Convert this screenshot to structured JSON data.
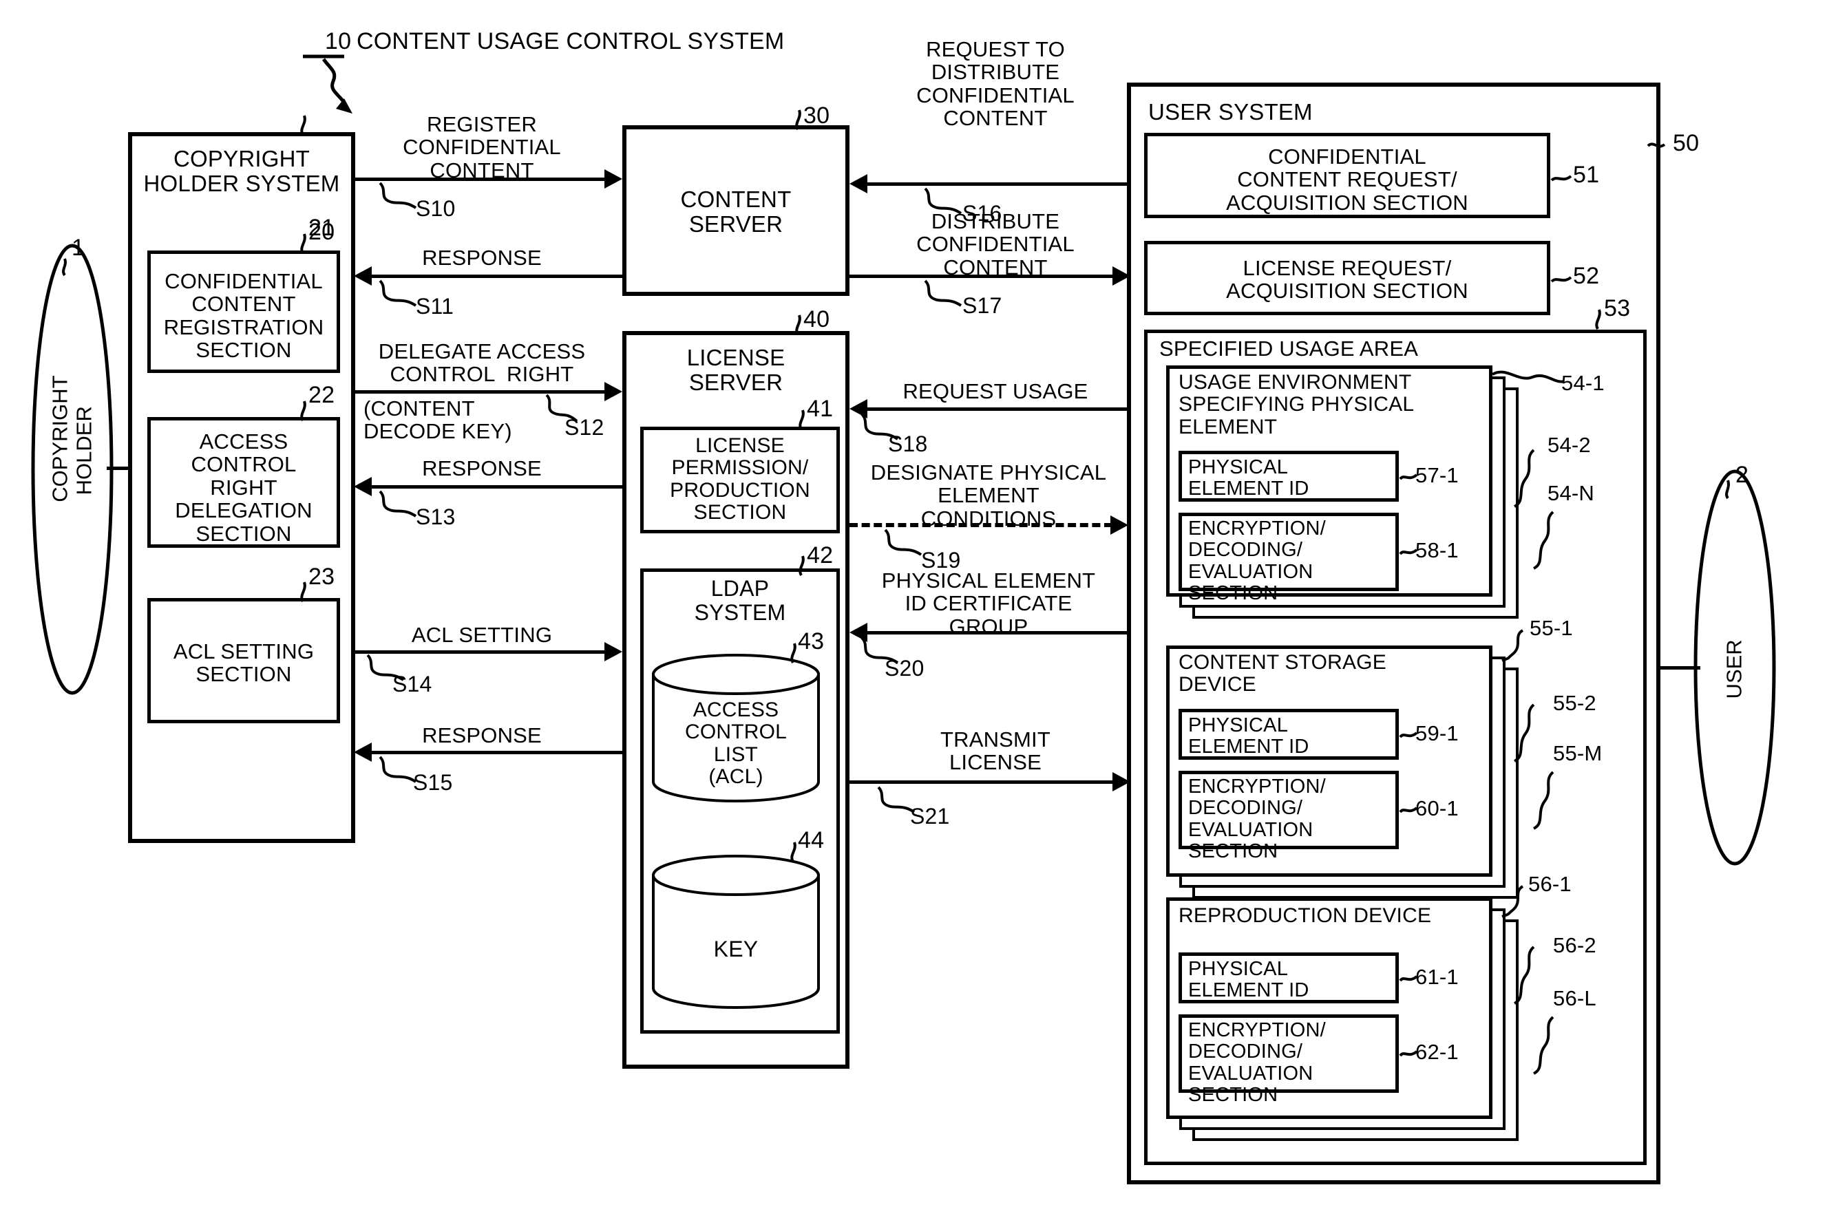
{
  "figure": {
    "system_ref": "10",
    "system_title": "CONTENT USAGE CONTROL SYSTEM"
  },
  "actors": {
    "copyright_holder": {
      "ref": "1",
      "label": "COPYRIGHT\nHOLDER"
    },
    "user": {
      "ref": "2",
      "label": "USER"
    }
  },
  "copyright_holder_system": {
    "ref": "20",
    "title": "COPYRIGHT\nHOLDER SYSTEM",
    "sections": [
      {
        "ref": "21",
        "label": "CONFIDENTIAL\nCONTENT\nREGISTRATION\nSECTION"
      },
      {
        "ref": "22",
        "label": "ACCESS\nCONTROL\nRIGHT\nDELEGATION\nSECTION"
      },
      {
        "ref": "23",
        "label": "ACL SETTING\nSECTION"
      }
    ]
  },
  "content_server": {
    "ref": "30",
    "title": "CONTENT\nSERVER"
  },
  "license_server": {
    "ref": "40",
    "title": "LICENSE\nSERVER",
    "permission_section": {
      "ref": "41",
      "label": "LICENSE\nPERMISSION/\nPRODUCTION\nSECTION"
    },
    "ldap": {
      "ref": "42",
      "label": "LDAP\nSYSTEM",
      "stores": [
        {
          "ref": "43",
          "label": "ACCESS\nCONTROL\nLIST\n(ACL)"
        },
        {
          "ref": "44",
          "label": "KEY"
        }
      ]
    }
  },
  "user_system": {
    "ref": "50",
    "title": "USER SYSTEM",
    "sections": [
      {
        "ref": "51",
        "label": "CONFIDENTIAL\nCONTENT REQUEST/\nACQUISITION SECTION"
      },
      {
        "ref": "52",
        "label": "LICENSE REQUEST/\nACQUISITION SECTION"
      }
    ],
    "specified_usage_area": {
      "ref": "53",
      "title": "SPECIFIED USAGE AREA",
      "groups": [
        {
          "title": "USAGE ENVIRONMENT\nSPECIFYING PHYSICAL\nELEMENT",
          "refs": [
            "54-1",
            "54-2",
            "54-N"
          ],
          "children": [
            {
              "ref": "57-1",
              "label": "PHYSICAL\nELEMENT ID"
            },
            {
              "ref": "58-1",
              "label": "ENCRYPTION/\nDECODING/\nEVALUATION\nSECTION"
            }
          ]
        },
        {
          "title": "CONTENT STORAGE\nDEVICE",
          "refs": [
            "55-1",
            "55-2",
            "55-M"
          ],
          "children": [
            {
              "ref": "59-1",
              "label": "PHYSICAL\nELEMENT ID"
            },
            {
              "ref": "60-1",
              "label": "ENCRYPTION/\nDECODING/\nEVALUATION\nSECTION"
            }
          ]
        },
        {
          "title": "REPRODUCTION DEVICE",
          "refs": [
            "56-1",
            "56-2",
            "56-L"
          ],
          "children": [
            {
              "ref": "61-1",
              "label": "PHYSICAL\nELEMENT ID"
            },
            {
              "ref": "62-1",
              "label": "ENCRYPTION/\nDECODING/\nEVALUATION\nSECTION"
            }
          ]
        }
      ]
    }
  },
  "flows": [
    {
      "step": "S10",
      "label": "REGISTER\nCONFIDENTIAL\nCONTENT",
      "direction": "right"
    },
    {
      "step": "S11",
      "label": "RESPONSE",
      "direction": "left"
    },
    {
      "step": "S12",
      "label": "DELEGATE ACCESS\nCONTROL  RIGHT",
      "sublabel": "(CONTENT\nDECODE KEY)",
      "direction": "right"
    },
    {
      "step": "S13",
      "label": "RESPONSE",
      "direction": "left"
    },
    {
      "step": "S14",
      "label": "ACL SETTING",
      "direction": "right"
    },
    {
      "step": "S15",
      "label": "RESPONSE",
      "direction": "left"
    },
    {
      "step": "S16",
      "label": "REQUEST TO\nDISTRIBUTE\nCONFIDENTIAL\nCONTENT",
      "direction": "left"
    },
    {
      "step": "S17",
      "label": "DISTRIBUTE\nCONFIDENTIAL\nCONTENT",
      "direction": "right"
    },
    {
      "step": "S18",
      "label": "REQUEST USAGE",
      "direction": "left"
    },
    {
      "step": "S19",
      "label": "DESIGNATE PHYSICAL\nELEMENT\nCONDITIONS",
      "direction": "right",
      "style": "dashed"
    },
    {
      "step": "S20",
      "label": "PHYSICAL ELEMENT\nID CERTIFICATE\nGROUP",
      "direction": "left"
    },
    {
      "step": "S21",
      "label": "TRANSMIT\nLICENSE",
      "direction": "right"
    }
  ]
}
